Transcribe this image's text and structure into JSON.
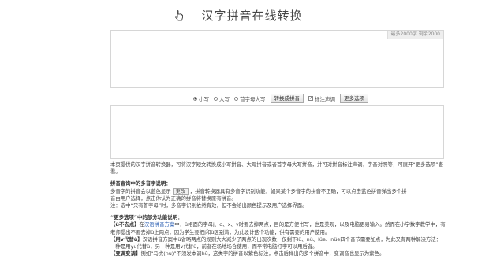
{
  "page": {
    "title": "汉字拼音在线转换"
  },
  "counter": {
    "limit_text": "最多2000字",
    "current_text": "剩余2000"
  },
  "options": {
    "radios": [
      {
        "label": "小写",
        "selected": true
      },
      {
        "label": "大写",
        "selected": false
      },
      {
        "label": "首字母大写",
        "selected": false
      }
    ],
    "convert_button": "转换成拼音",
    "tone_checkbox": {
      "label": "标注声调",
      "checked": true
    },
    "more_button": "更多选项"
  },
  "content": {
    "intro": "本页提供的汉字拼音转换器，可将汉字短文转换成小写拼音、大写拼音或者首字母大写拼音，并可对拼音标注声调，字音对照等，可展开“更多选项”查看。",
    "multi_heading": "拼音查询中的多音字说明：",
    "multi_line1_pre": "多音字的拼音会以蓝色显示",
    "multi_line1_btn": "更改",
    "multi_line1_post": "，拼音转换器具有多音字识别功能，如果某个多音字的拼音不正确，可以点击蓝色拼音弹出多个拼",
    "multi_line2": "音由用户选择，点击你认为正确的拼音将替换原有拼音。",
    "multi_note": "注：选中“只有首字母”时，多音字识别依然有效，但不会给出颜色提示及用户选择界面。",
    "more_heading": "“更多选项”中的部分功能说明：",
    "item1_tag": "【ü不去点】",
    "item1_pre": "在",
    "item1_link": "汉语拼音方案",
    "item1_text": "中，ü相面的字母j、q、x、y时要去掉两点，目的是方便书写，也是美观，以及电脑更易输入。然而在小学数字教学中，有老师提出不要去掉ü上两点，因为学生要把j和ü区别清，为此设计这个功能，供有需要的用户使用。",
    "item2_tag": "【用v代替ü】",
    "item2_text": "汉语拼音方案中ü省略两点的规则大大减少了两点的出现次数，仅剩下lü、nü、lüe、nüe四个音节需要加点，为此又有两种解决方法：一种是用yu代替ü，另一种是用v代替ü，前者在场地场合使用，而平常电脑打字可以用后者。",
    "item3_tag": "【变调变调】",
    "item3_text": "例如“马虎(hu)”不须发本调hū，这类字的拼音以紫色标注，点击后弹出的多个拼音中，变调音也显示为紫色。"
  }
}
